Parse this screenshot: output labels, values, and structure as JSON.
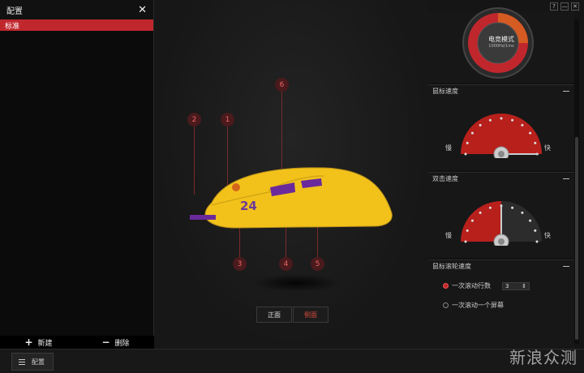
{
  "left_panel": {
    "title": "配置",
    "profiles": [
      "标准"
    ],
    "footer": {
      "new_label": "新建",
      "delete_label": "删除"
    }
  },
  "bottom_bar": {
    "config_label": "配置"
  },
  "center": {
    "callouts": [
      "1",
      "2",
      "3",
      "4",
      "5",
      "6"
    ],
    "mouse_number": "24",
    "views": {
      "front": "正面",
      "side": "侧面"
    }
  },
  "window_controls": {
    "help": "?",
    "min": "—",
    "close": "✕"
  },
  "right_panel": {
    "mode_gauge": {
      "label": "电竞模式",
      "sub": "1000Hz/1ms"
    },
    "pointer_speed": {
      "title": "鼠标速度",
      "slow": "慢",
      "fast": "快",
      "level": 1.0
    },
    "double_click": {
      "title": "双击速度",
      "slow": "慢",
      "fast": "快",
      "level": 0.5
    },
    "scroll_speed": {
      "title": "鼠标滚轮速度",
      "option_lines": "一次滚动行数",
      "option_lines_value": "3",
      "option_screen": "一次滚动一个屏幕"
    }
  },
  "watermark": "新浪众测",
  "colors": {
    "accent": "#c0272d",
    "gauge_active": "#b8201c",
    "mouse_body": "#f2c21b"
  }
}
